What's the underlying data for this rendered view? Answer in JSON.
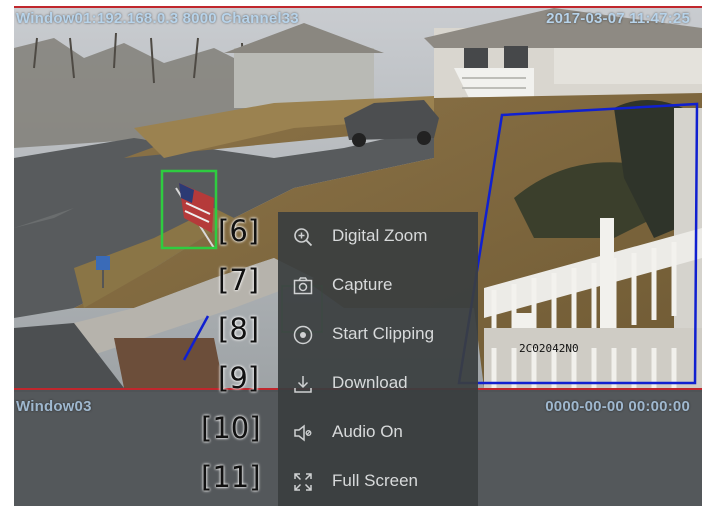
{
  "window1": {
    "title": "Window01:192.168.0.3  8000  Channel33",
    "timestamp": "2017-03-07 11:47:25"
  },
  "window2": {
    "title": "Window03",
    "timestamp": "0000-00-00 00:00:00"
  },
  "scene": {
    "plate_text": "2C02042N0"
  },
  "context_menu": {
    "items": [
      {
        "label": "Digital Zoom",
        "icon": "zoom-in-icon",
        "tag": "[6]"
      },
      {
        "label": "Capture",
        "icon": "camera-icon",
        "tag": "[7]"
      },
      {
        "label": "Start Clipping",
        "icon": "record-icon",
        "tag": "[8]"
      },
      {
        "label": "Download",
        "icon": "download-icon",
        "tag": "[9]"
      },
      {
        "label": "Audio On",
        "icon": "speaker-icon",
        "tag": "[10]"
      },
      {
        "label": "Full Screen",
        "icon": "fullscreen-icon",
        "tag": "[11]"
      }
    ]
  },
  "colors": {
    "window_border": "#c0272d",
    "osd_text": "#b7d3ea",
    "menu_bg": "#3a3e40",
    "detect_green": "#2ecc40",
    "detect_blue": "#1020d0"
  }
}
